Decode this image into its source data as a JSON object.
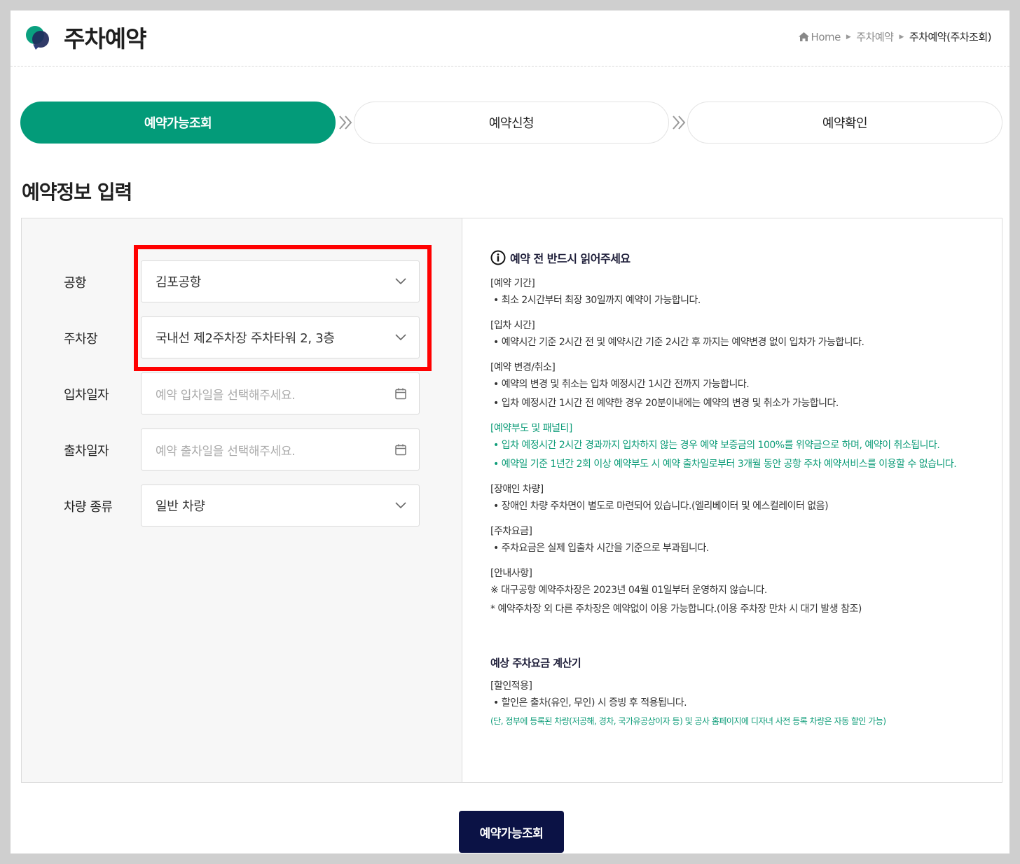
{
  "header": {
    "title": "주차예약",
    "breadcrumb": [
      "Home",
      "주차예약",
      "주차예약(주차조회)"
    ]
  },
  "steps": [
    {
      "label": "예약가능조회",
      "active": true
    },
    {
      "label": "예약신청",
      "active": false
    },
    {
      "label": "예약확인",
      "active": false
    }
  ],
  "section_title": "예약정보 입력",
  "form": {
    "airport_label": "공항",
    "airport_value": "김포공항",
    "parking_label": "주차장",
    "parking_value": "국내선 제2주차장 주차타워 2, 3층",
    "entry_label": "입차일자",
    "entry_placeholder": "예약 입차일을 선택해주세요.",
    "exit_label": "출차일자",
    "exit_placeholder": "예약 출차일을 선택해주세요.",
    "vehicle_label": "차량 종류",
    "vehicle_value": "일반 차량"
  },
  "notice": {
    "title": "예약 전 반드시 읽어주세요",
    "blocks": [
      {
        "head": "[예약 기간]",
        "lines": [
          "• 최소 2시간부터 최장 30일까지 예약이 가능합니다."
        ]
      },
      {
        "head": "[입차 시간]",
        "lines": [
          "• 예약시간 기준 2시간 전 및 예약시간 기준 2시간 후 까지는 예약변경 없이 입차가 가능합니다."
        ]
      },
      {
        "head": "[예약 변경/취소]",
        "lines": [
          "• 예약의 변경 및 취소는 입차 예정시간 1시간 전까지 가능합니다.",
          "• 입차 예정시간 1시간 전 예약한 경우 20분이내에는 예약의 변경 및 취소가 가능합니다."
        ]
      },
      {
        "head": "[예약부도 및 패널티]",
        "lines": [
          "• 입차 예정시간 2시간 경과까지 입차하지 않는 경우 예약 보증금의 100%를 위약금으로 하며, 예약이 취소됩니다.",
          "• 예약일 기준 1년간 2회 이상 예약부도 시 예약 출차일로부터 3개월 동안 공항 주차 예약서비스를 이용할 수 없습니다."
        ]
      },
      {
        "head": "[장애인 차량]",
        "lines": [
          "• 장애인 차량 주차면이 별도로 마련되어 있습니다.(엘리베이터 및 에스컬레이터 없음)"
        ]
      },
      {
        "head": "[주차요금]",
        "lines": [
          "• 주차요금은 실제 입출차 시간을 기준으로 부과됩니다."
        ]
      },
      {
        "head": "[안내사항]",
        "lines": [
          "※ 대구공항 예약주차장은 2023년 04월 01일부터 운영하지 않습니다.",
          "* 예약주차장 외 다른 주차장은 예약없이 이용 가능합니다.(이용 주차장 만차 시 대기 발생 참조)"
        ]
      }
    ],
    "calc_title": "예상 주차요금 계산기",
    "discount_head": "[할인적용]",
    "discount_line": "• 할인은 출차(유인, 무인) 시 증빙 후 적용됩니다.",
    "discount_note": "(단, 정부에 등록된 차량(저공해, 경차, 국가유공상이자 등) 및 공사 홈페이지에 디자녀 사전 등록 차량은 자동 할인 가능)"
  },
  "submit_label": "예약가능조회",
  "colors": {
    "accent": "#039b79",
    "navy": "#0b1245",
    "highlight": "#ff0000",
    "notice_green": "#0d9c78"
  }
}
